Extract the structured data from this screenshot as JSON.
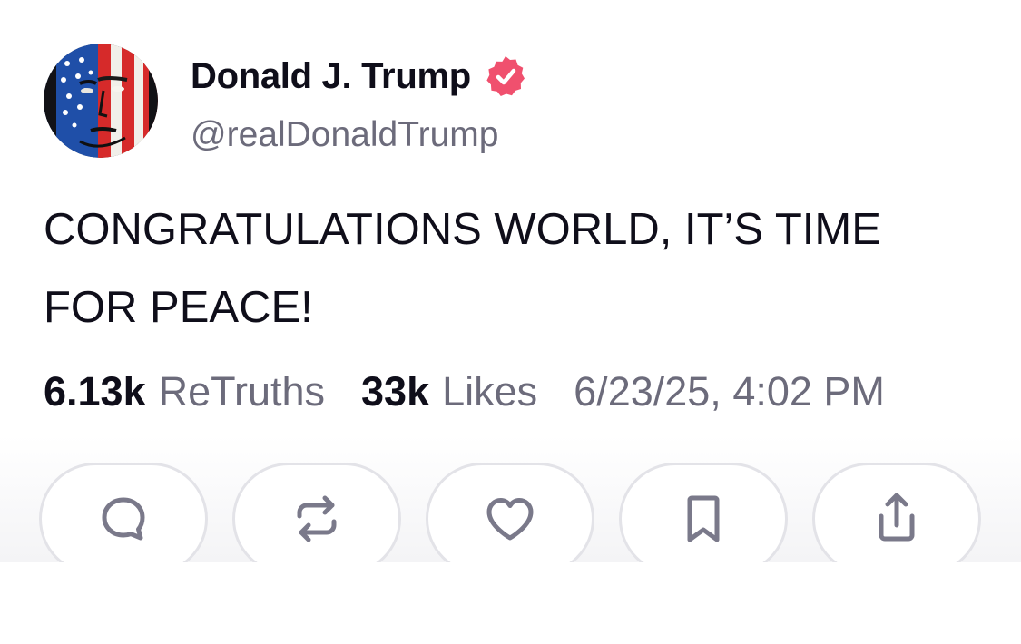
{
  "author": {
    "display_name": "Donald J. Trump",
    "handle": "@realDonaldTrump",
    "verified": true,
    "verified_color": "#f0506e",
    "avatar_icon": "flag-face-avatar"
  },
  "post": {
    "line1": "CONGRATULATIONS WORLD, IT’S TIME",
    "line2": "FOR PEACE!"
  },
  "stats": {
    "retruths_count": "6.13k",
    "retruths_label": "ReTruths",
    "likes_count": "33k",
    "likes_label": "Likes",
    "timestamp": "6/23/25, 4:02 PM"
  },
  "actions": [
    {
      "icon": "reply-icon"
    },
    {
      "icon": "retruth-icon"
    },
    {
      "icon": "like-icon"
    },
    {
      "icon": "bookmark-icon"
    },
    {
      "icon": "share-icon"
    }
  ],
  "colors": {
    "text_primary": "#0f0e1a",
    "text_secondary": "#6c6b7b",
    "icon_gray": "#7a798a",
    "button_border": "#e3e3e8"
  }
}
